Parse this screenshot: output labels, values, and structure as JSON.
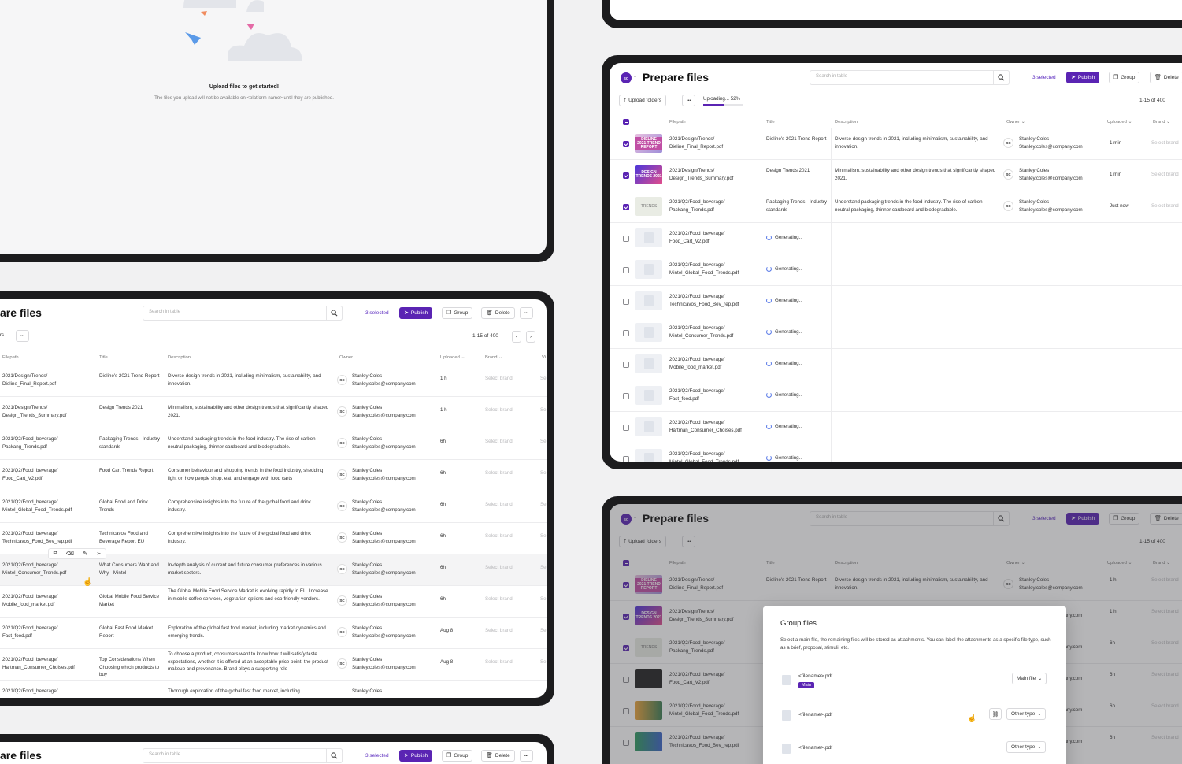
{
  "empty_state": {
    "title": "Upload files to get started!",
    "subtitle": "The files you upload will not be available on <platform name> until they are published."
  },
  "header": {
    "title": "Prepare files",
    "title_cropped": "are files",
    "avatar": "SC",
    "search_placeholder": "Search in table",
    "selected": "3 selected",
    "publish": "Publish",
    "group": "Group",
    "delete": "Delete",
    "more": "•••",
    "upload_folders": "Upload folders",
    "uploading": "Uploading... 52%",
    "pagination": "1-15 of 400",
    "upload_folders_cropped": "rs"
  },
  "columns": {
    "filepath": "Filepath",
    "title": "Title",
    "description": "Description",
    "owner": "Owner",
    "uploaded": "Uploaded",
    "brand": "Brand",
    "extra": "Vi"
  },
  "owner": {
    "name": "Stanley Coles",
    "email": "Stanley.coles@company.com",
    "initials": "SC"
  },
  "brand_placeholder": "Select brand",
  "brand_placeholder_cropped": "Se",
  "generating": "Generating..",
  "left_rows": [
    {
      "path1": "2021/Design/Trends/",
      "path2": "Dieline_Final_Report.pdf",
      "title": "Dieline's 2021 Trend Report",
      "desc": "Diverse design trends in 2021, including minimalism, sustainability, and innovation.",
      "uploaded": "1 h"
    },
    {
      "path1": "2021/Design/Trends/",
      "path2": "Design_Trends_Summary.pdf",
      "title": "Design Trends 2021",
      "desc": "Minimalism, sustainability and other design trends that significantly shaped 2021.",
      "uploaded": "1 h"
    },
    {
      "path1": "2021/Q2/Food_beverage/",
      "path2": "Packang_Trends.pdf",
      "title": "Packaging Trends - Industry standards",
      "desc": "Understand packaging trends in the food industry. The rise of carbon neutral packaging, thinner cardboard and biodegradable.",
      "uploaded": "6h"
    },
    {
      "path1": "2021/Q2/Food_beverage/",
      "path2": "Food_Cart_V2.pdf",
      "title": "Food Cart Trends Report",
      "desc": "Consumer behaviour and shopping trends in the food industry, shedding light on how people shop, eat, and engage with food carts",
      "uploaded": "6h"
    },
    {
      "path1": "2021/Q2/Food_beverage/",
      "path2": "Mintel_Global_Food_Trends.pdf",
      "title": "Global Food and Drink Trends",
      "desc": "Comprehensive insights into the future of the global food and drink industry.",
      "uploaded": "6h"
    },
    {
      "path1": "2021/Q2/Food_beverage/",
      "path2": "Technicavos_Food_Bev_rep.pdf",
      "title": "Technicavos Food and Beverage Report EU",
      "desc": "Comprehensive insights into the future of the global food and drink industry.",
      "uploaded": "6h"
    },
    {
      "path1": "2021/Q2/Food_beverage/",
      "path2": "Mintel_Consumer_Trends.pdf",
      "title": "What Consumers Want and Why - Mintel",
      "desc": "In-depth analysis of current and future consumer preferences in various market sectors.",
      "uploaded": "6h"
    },
    {
      "path1": "2021/Q2/Food_beverage/",
      "path2": "Mobile_food_market.pdf",
      "title": "Global Mobile Food Service Market",
      "desc": "The Global Mobile Food Service Market is evolving rapidly in EU. Increase in mobile coffee services, vegetarian options and eco-friendly vendors.",
      "uploaded": "6h"
    },
    {
      "path1": "2021/Q2/Food_beverage/",
      "path2": "Fast_food.pdf",
      "title": "Global Fast Food Market Report",
      "desc": "Exploration of the global fast food market, including market dynamics and emerging trends.",
      "uploaded": "Aug 8"
    },
    {
      "path1": "2021/Q2/Food_beverage/",
      "path2": "Hartman_Consumer_Choises.pdf",
      "title": "Top Considerations When Choosing which products to buy",
      "desc": "To choose a product, consumers want to know how it will satisfy taste expectations, whether it is offered at an acceptable price point, the product makeup and provenance. Brand plays a supporting role",
      "uploaded": "Aug 8"
    },
    {
      "path1": "2021/Q2/Food_beverage/",
      "path2": "",
      "title": "",
      "desc": "Thorough exploration of the global fast food market, including",
      "uploaded": ""
    }
  ],
  "right_rows": [
    {
      "path1": "2021/Design/Trends/",
      "path2": "Dieline_Final_Report.pdf",
      "title": "Dieline's 2021 Trend Report",
      "desc": "Diverse design trends in 2021, including minimalism, sustainability, and innovation.",
      "uploaded": "1 min",
      "checked": true,
      "thumb": "DIELINE 2021 TREND REPORT"
    },
    {
      "path1": "2021/Design/Trends/",
      "path2": "Design_Trends_Summary.pdf",
      "title": "Design Trends 2021",
      "desc": "Minimalism, sustainability and other design trends that significantly shaped 2021.",
      "uploaded": "1 min",
      "checked": true,
      "thumb": "DESIGN TRENDS 2021"
    },
    {
      "path1": "2021/Q2/Food_beverage/",
      "path2": "Packang_Trends.pdf",
      "title": "Packaging Trends - Industry standards",
      "desc": "Understand packaging trends in the food industry. The rise of carbon neutral packaging, thinner cardboard and biodegradable.",
      "uploaded": "Just now",
      "checked": true,
      "thumb": "TRENDS"
    },
    {
      "path1": "2021/Q2/Food_beverage/",
      "path2": "Food_Cart_V2.pdf"
    },
    {
      "path1": "2021/Q2/Food_beverage/",
      "path2": "Mintel_Global_Food_Trends.pdf"
    },
    {
      "path1": "2021/Q2/Food_beverage/",
      "path2": "Technicavos_Food_Bev_rep.pdf"
    },
    {
      "path1": "2021/Q2/Food_beverage/",
      "path2": "Mintel_Consumer_Trends.pdf"
    },
    {
      "path1": "2021/Q2/Food_beverage/",
      "path2": "Mobile_food_market.pdf"
    },
    {
      "path1": "2021/Q2/Food_beverage/",
      "path2": "Fast_food.pdf"
    },
    {
      "path1": "2021/Q2/Food_beverage/",
      "path2": "Hartman_Consumer_Choises.pdf"
    },
    {
      "path1": "2021/Q2/Food_beverage/",
      "path2": "Mintel_Global_Food_Trends.pdf"
    }
  ],
  "grouped_rows": [
    {
      "path1": "2021/Design/Trends/",
      "path2": "Dieline_Final_Report.pdf",
      "title": "Dieline's 2021 Trend Report",
      "desc": "Diverse design trends in 2021, including minimalism, sustainability, and innovation.",
      "uploaded": "1 h",
      "email": "Stanley.coles@company.com",
      "checked": true
    },
    {
      "path1": "2021/Design/Trends/",
      "path2": "Design_Trends_Summary.pdf",
      "uploaded": "1 h",
      "email": "pany.com",
      "checked": true
    },
    {
      "path1": "2021/Q2/Food_beverage/",
      "path2": "Packang_Trends.pdf",
      "uploaded": "6h",
      "email": "pany.com",
      "checked": true
    },
    {
      "path1": "2021/Q2/Food_beverage/",
      "path2": "Food_Cart_V2.pdf",
      "uploaded": "6h",
      "email": "pany.com",
      "checked": false
    },
    {
      "path1": "2021/Q2/Food_beverage/",
      "path2": "Mintel_Global_Food_Trends.pdf",
      "uploaded": "6h",
      "email": "pany.com",
      "checked": false
    },
    {
      "path1": "2021/Q2/Food_beverage/",
      "path2": "Technicavos_Food_Bev_rep.pdf",
      "uploaded": "6h",
      "email": "pany.com",
      "checked": false
    }
  ],
  "group_modal": {
    "title": "Group files",
    "desc": "Select a main file, the remaining files will be stored as attachments. You can label the attachments as a specific file type, such as a brief, proposal, stimuli, etc.",
    "files": [
      {
        "name": "<filename>.pdf",
        "badge": "Main",
        "type": "Main file"
      },
      {
        "name": "<filename>.pdf",
        "badge": "",
        "type": "Other type"
      },
      {
        "name": "<filename>.pdf",
        "badge": "",
        "type": "Other type"
      }
    ]
  },
  "colors": {
    "accent": "#5a24b3",
    "device": "#1c1c1e",
    "background": "#f1f1f2"
  }
}
